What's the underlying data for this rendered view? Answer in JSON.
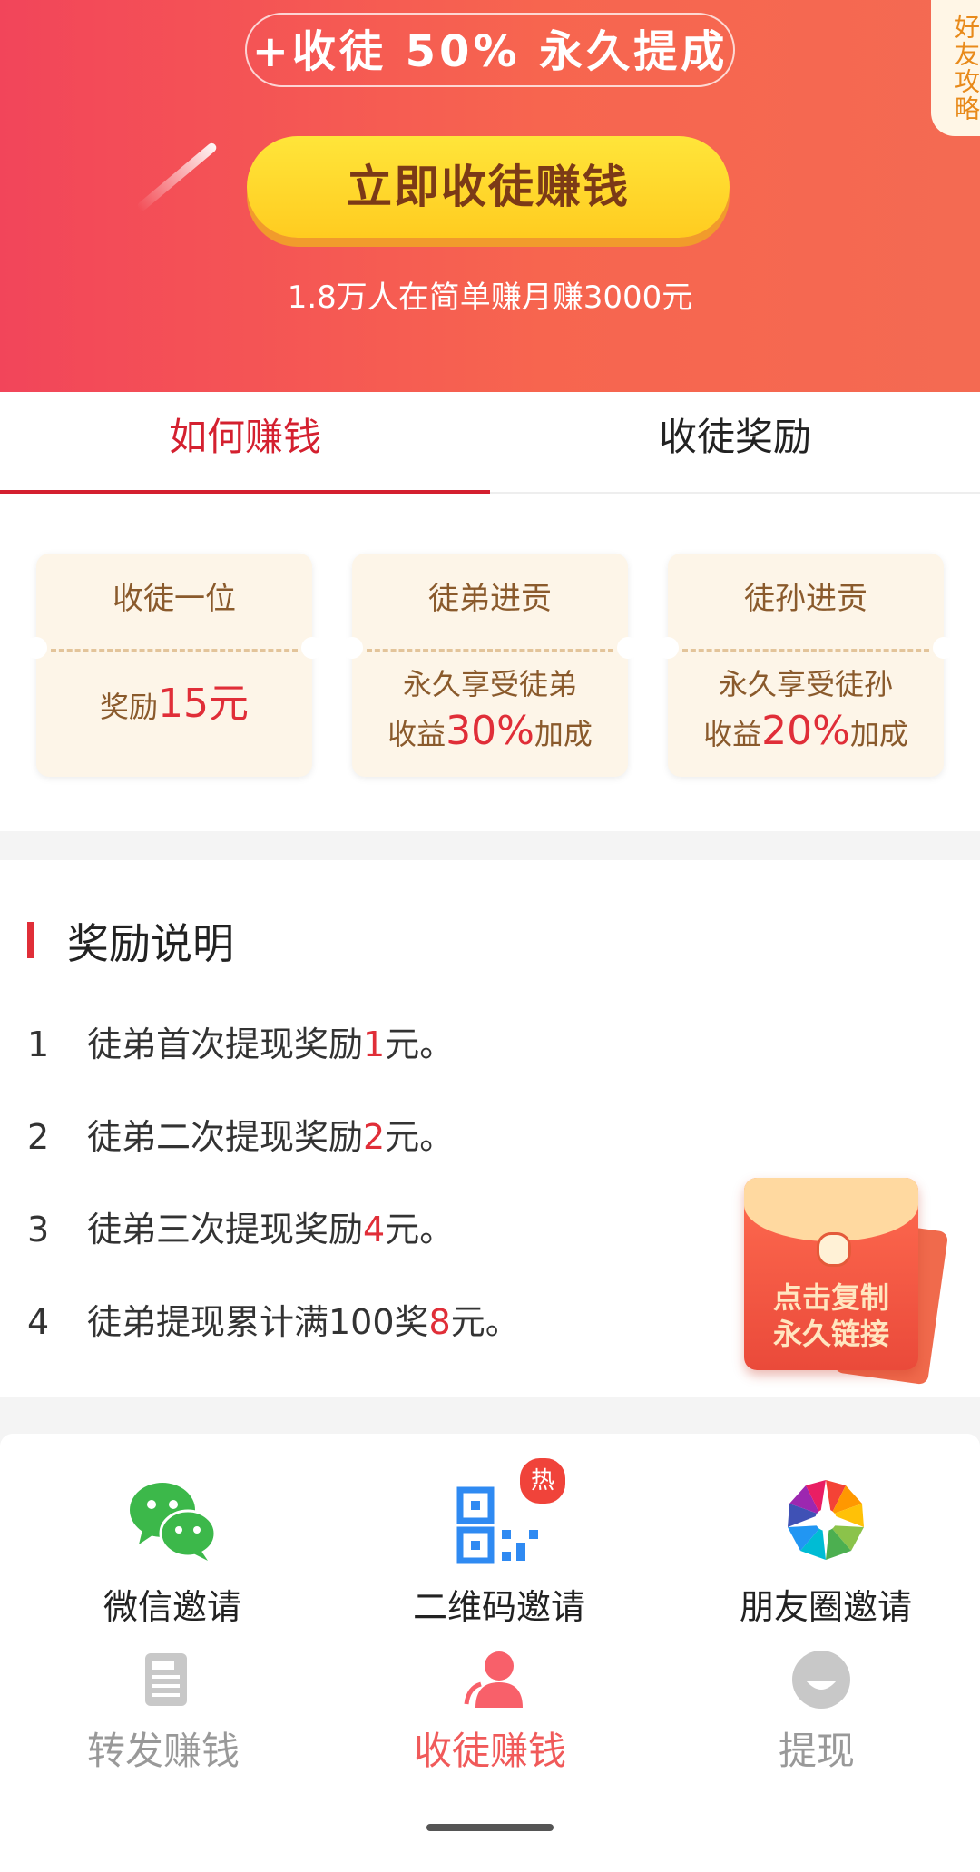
{
  "banner": {
    "slogan": "+收徒 50% 永久提成",
    "strategy_tab": "好友攻略",
    "cta_button": "立即收徒赚钱",
    "subtitle": "1.8万人在简单赚月赚3000元"
  },
  "tabs": [
    {
      "label": "如何赚钱",
      "active": true
    },
    {
      "label": "收徒奖励",
      "active": false
    }
  ],
  "cards": [
    {
      "title": "收徒一位",
      "line1_prefix": "奖励",
      "line1_value": "15元",
      "line1_suffix": "",
      "line2": ""
    },
    {
      "title": "徒弟进贡",
      "line1_prefix": "永久享受徒弟",
      "line2_prefix": "收益",
      "line2_value": "30%",
      "line2_suffix": "加成"
    },
    {
      "title": "徒孙进贡",
      "line1_prefix": "永久享受徒孙",
      "line2_prefix": "收益",
      "line2_value": "20%",
      "line2_suffix": "加成"
    }
  ],
  "explain": {
    "title": "奖励说明",
    "rules": [
      {
        "num": "1",
        "prefix": "徒弟首次提现奖励",
        "value": "1",
        "suffix": "元。"
      },
      {
        "num": "2",
        "prefix": "徒弟二次提现奖励",
        "value": "2",
        "suffix": "元。"
      },
      {
        "num": "3",
        "prefix": "徒弟三次提现奖励",
        "value": "4",
        "suffix": "元。"
      },
      {
        "num": "4",
        "prefix": "徒弟提现累计满100奖",
        "value": "8",
        "suffix": "元。"
      }
    ]
  },
  "envelope": {
    "line1": "点击复制",
    "line2": "永久链接"
  },
  "share": [
    {
      "label": "微信邀请",
      "icon": "wechat-icon"
    },
    {
      "label": "二维码邀请",
      "icon": "qrcode-icon",
      "badge": "热"
    },
    {
      "label": "朋友圈邀请",
      "icon": "moments-icon"
    }
  ],
  "bottom_nav": [
    {
      "label": "转发赚钱",
      "icon": "news-icon",
      "active": false
    },
    {
      "label": "收徒赚钱",
      "icon": "apprentice-icon",
      "active": true
    },
    {
      "label": "提现",
      "icon": "withdraw-icon",
      "active": false
    }
  ],
  "colors": {
    "accent_red": "#e02e38",
    "banner_red": "#f2455a",
    "cta_yellow": "#ffe53a",
    "card_bg": "#fdf5e8"
  }
}
